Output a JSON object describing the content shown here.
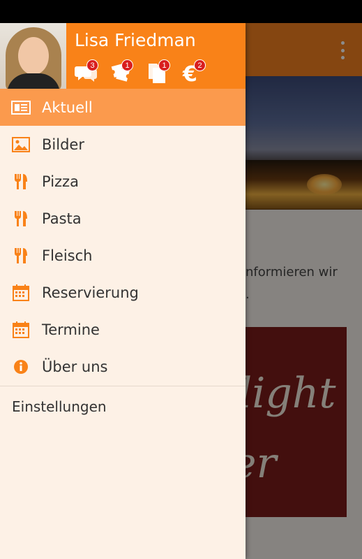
{
  "user": {
    "name": "Lisa Friedman",
    "avatar_icon": "user-photo"
  },
  "header_icons": [
    {
      "icon": "chat-icon",
      "badge": "3"
    },
    {
      "icon": "ticket-icon",
      "badge": "1"
    },
    {
      "icon": "copy-icon",
      "badge": "1"
    },
    {
      "icon": "euro-icon",
      "badge": "2"
    }
  ],
  "menu": {
    "items": [
      {
        "label": "Aktuell",
        "icon": "news-icon",
        "active": true
      },
      {
        "label": "Bilder",
        "icon": "image-icon",
        "active": false
      },
      {
        "label": "Pizza",
        "icon": "cutlery-icon",
        "active": false
      },
      {
        "label": "Pasta",
        "icon": "cutlery-icon",
        "active": false
      },
      {
        "label": "Fleisch",
        "icon": "cutlery-icon",
        "active": false
      },
      {
        "label": "Reservierung",
        "icon": "calendar-icon",
        "active": false
      },
      {
        "label": "Termine",
        "icon": "calendar-icon",
        "active": false
      },
      {
        "label": "Über uns",
        "icon": "info-icon",
        "active": false
      }
    ],
    "settings_label": "Einstellungen"
  },
  "background": {
    "text_line1": "nformieren wir",
    "text_line2": "."
  },
  "colors": {
    "accent": "#f98218",
    "active_item": "#fb9a4d",
    "drawer_bg": "#fdf1e6",
    "badge": "#d91e1e"
  }
}
